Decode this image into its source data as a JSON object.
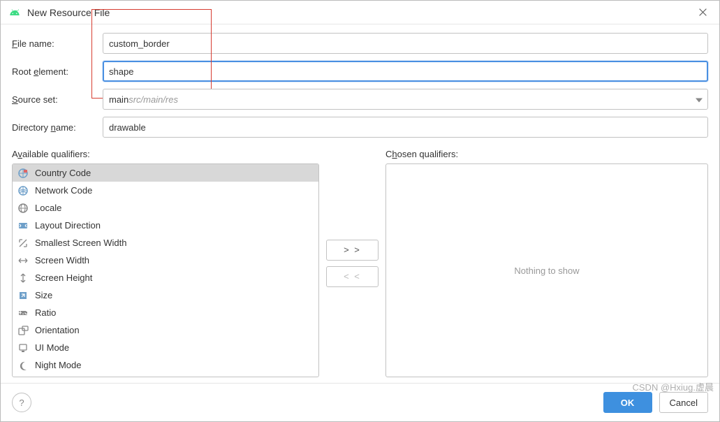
{
  "dialog": {
    "title": "New Resource File"
  },
  "fields": {
    "file_name": {
      "label_pre": "",
      "label_mn": "F",
      "label_post": "ile name:",
      "value": "custom_border"
    },
    "root_element": {
      "label_pre": "Root ",
      "label_mn": "e",
      "label_post": "lement:",
      "value": "shape"
    },
    "source_set": {
      "label_pre": "",
      "label_mn": "S",
      "label_post": "ource set:",
      "value_main": "main",
      "value_secondary": " src/main/res"
    },
    "directory_name": {
      "label_pre": "Directory ",
      "label_mn": "n",
      "label_post": "ame:",
      "value": "drawable"
    }
  },
  "available": {
    "label_pre": "A",
    "label_mn": "v",
    "label_post": "ailable qualifiers:",
    "items": [
      {
        "label": "Country Code",
        "icon": "globe-flag-icon",
        "selected": true
      },
      {
        "label": "Network Code",
        "icon": "globe-net-icon"
      },
      {
        "label": "Locale",
        "icon": "globe-icon"
      },
      {
        "label": "Layout Direction",
        "icon": "arrows-lr-icon"
      },
      {
        "label": "Smallest Screen Width",
        "icon": "arrows-diag-icon"
      },
      {
        "label": "Screen Width",
        "icon": "arrows-h-icon"
      },
      {
        "label": "Screen Height",
        "icon": "arrows-v-icon"
      },
      {
        "label": "Size",
        "icon": "expand-icon"
      },
      {
        "label": "Ratio",
        "icon": "ratio-icon"
      },
      {
        "label": "Orientation",
        "icon": "orientation-icon"
      },
      {
        "label": "UI Mode",
        "icon": "ui-mode-icon"
      },
      {
        "label": "Night Mode",
        "icon": "night-icon"
      }
    ]
  },
  "chosen": {
    "label_pre": "C",
    "label_mn": "h",
    "label_post": "osen qualifiers:",
    "empty_text": "Nothing to show"
  },
  "buttons": {
    "add": "> >",
    "remove": "< <",
    "ok": "OK",
    "cancel": "Cancel",
    "help": "?"
  },
  "watermark": "CSDN @Hxiug.虚晨"
}
